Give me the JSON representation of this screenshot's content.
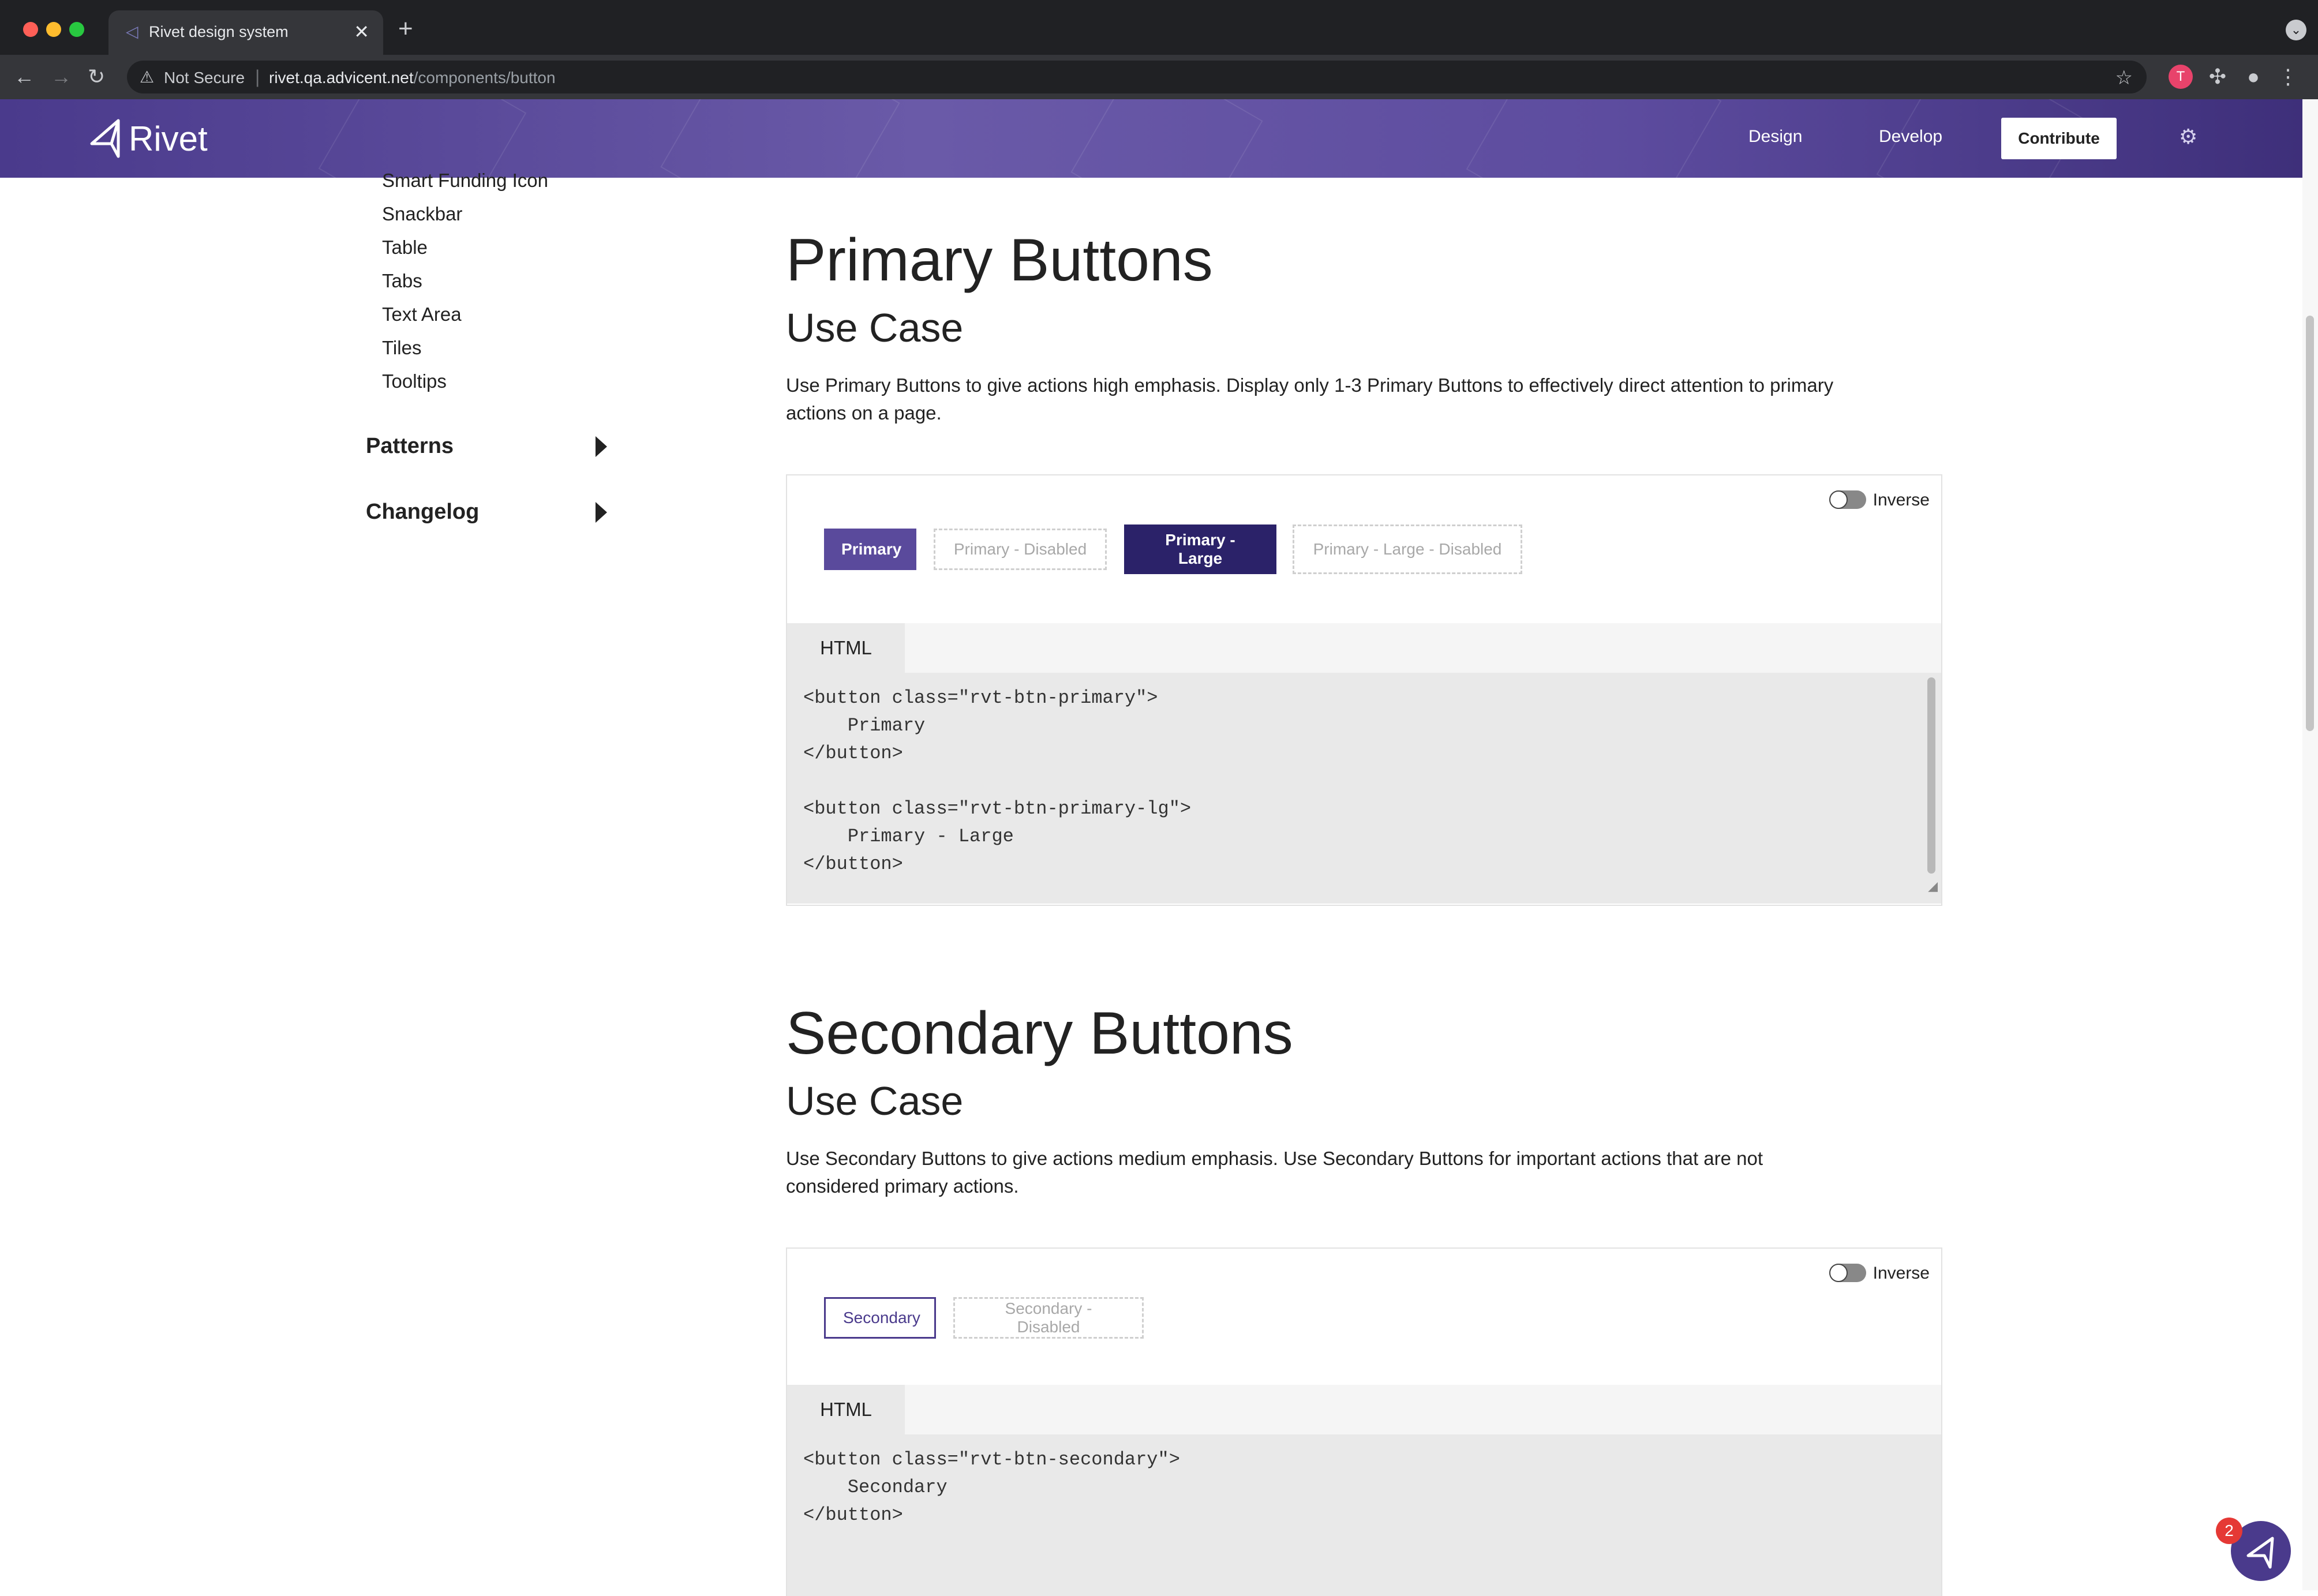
{
  "browser": {
    "tab_title": "Rivet design system",
    "tab_close": "✕",
    "new_tab": "+",
    "security_label": "Not Secure",
    "url_host": "rivet.qa.advicent.net",
    "url_path": "/components/button",
    "profile_initial": "T"
  },
  "header": {
    "logo_text": "Rivet",
    "nav": {
      "design": "Design",
      "develop": "Develop"
    },
    "contribute_label": "Contribute"
  },
  "sidebar": {
    "items": [
      "Smart Funding Icon",
      "Snackbar",
      "Table",
      "Tabs",
      "Text Area",
      "Tiles",
      "Tooltips"
    ],
    "sections": [
      "Patterns",
      "Changelog"
    ]
  },
  "primary_section": {
    "title": "Primary Buttons",
    "subtitle": "Use Case",
    "description": "Use Primary Buttons to give actions high emphasis. Display only 1-3 Primary Buttons to effectively direct attention to primary actions on a page.",
    "toggle_label": "Inverse",
    "buttons": [
      "Primary",
      "Primary - Disabled",
      "Primary - Large",
      "Primary - Large - Disabled"
    ],
    "code_tab": "HTML",
    "code": "<button class=\"rvt-btn-primary\">\n    Primary\n</button>\n\n<button class=\"rvt-btn-primary-lg\">\n    Primary - Large\n</button>"
  },
  "secondary_section": {
    "title": "Secondary Buttons",
    "subtitle": "Use Case",
    "description": "Use Secondary Buttons to give actions medium emphasis. Use Secondary Buttons for important actions that are not considered primary actions.",
    "toggle_label": "Inverse",
    "buttons": [
      "Secondary",
      "Secondary - Disabled"
    ],
    "code_tab": "HTML",
    "code": "<button class=\"rvt-btn-secondary\">\n    Secondary\n</button>"
  },
  "chat": {
    "badge_count": "2"
  },
  "colors": {
    "brand": "#4a3a8c",
    "brand_dark": "#2b2269",
    "primary": "#5a4a9c"
  }
}
